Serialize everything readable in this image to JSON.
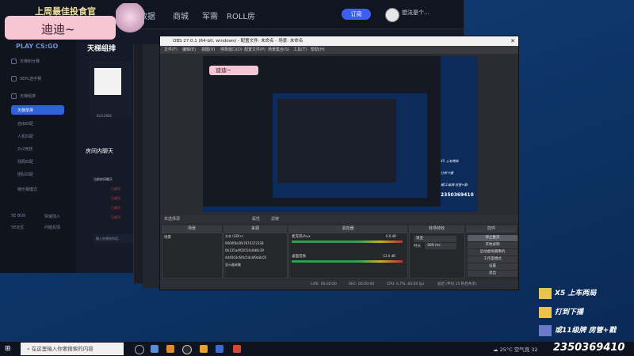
{
  "client": {
    "brand": "上周最佳投食官",
    "nav": [
      "数据",
      "商城",
      "军需",
      "ROLL房"
    ],
    "open_button": "订阅",
    "username": "想法是个…",
    "game_tag": "PLAY CS:GO",
    "ladder_title": "天梯组排",
    "sidebar": [
      "天梯积分赛",
      "5EPL选手赛",
      "天梯组排",
      "天梯单排",
      "自由匹配",
      "人机匹配",
      "2v2竞技",
      "残局匹配",
      "团队匹配",
      "娱乐赛模式",
      "5E BOX",
      "5E社区",
      "快速加入",
      "问题反馈"
    ],
    "profile_elo": "ELO:2081",
    "chat_title": "房间内聊天",
    "chat_lines": [
      "当前房间聊天",
      "已成功",
      "已成功",
      "已成功",
      "已成功"
    ],
    "chat_placeholder": "输入你想说的话..."
  },
  "overlay": {
    "name_tag": "迪迪~",
    "items": [
      "X5 上车两局",
      "打到下播",
      "或11级牌 房管+戳"
    ],
    "room_id": "2350369410"
  },
  "obs": {
    "title": "OBS 27.0.1 (64-bit, windows) - 配置文件: 未命名 - 场景: 未命名",
    "menu": [
      "文件(F)",
      "编辑(E)",
      "视图(V)",
      "停靠窗口(D)",
      "配置文件(P)",
      "场景集合(S)",
      "工具(T)",
      "帮助(H)"
    ],
    "scene_bar": [
      "未选择源",
      "属性",
      "滤镜"
    ],
    "docks": [
      "场景",
      "来源",
      "混音器",
      "转场特效",
      "控件"
    ],
    "scene_item": "场景",
    "sources": [
      "文本 (GDI+)",
      "9000f8a5fb7874372338",
      "0b135a4f02014c8d8c39",
      "4d40d3c6f4c54cbf0a8c05",
      "显示器采集"
    ],
    "mixer": [
      "麦克风/Aux",
      "桌面音频"
    ],
    "mixer_db": [
      "0.0 dB",
      "-12.0 dB"
    ],
    "transition": "渐变",
    "duration_label": "时长",
    "duration": "300 ms",
    "controls": [
      "停止推流",
      "开始录制",
      "启动虚拟摄像机",
      "工作室模式",
      "设置",
      "退出"
    ],
    "status": [
      "LIVE: 00:00:00",
      "REC: 00:00:00",
      "CPU: 0.7%, 60.00 fps",
      "延迟 (平均 15 秒后共享)"
    ]
  },
  "taskbar": {
    "search_placeholder": "在这里输入你要搜索的内容",
    "weather": "25°C 空气良 32",
    "date_hint": ""
  }
}
